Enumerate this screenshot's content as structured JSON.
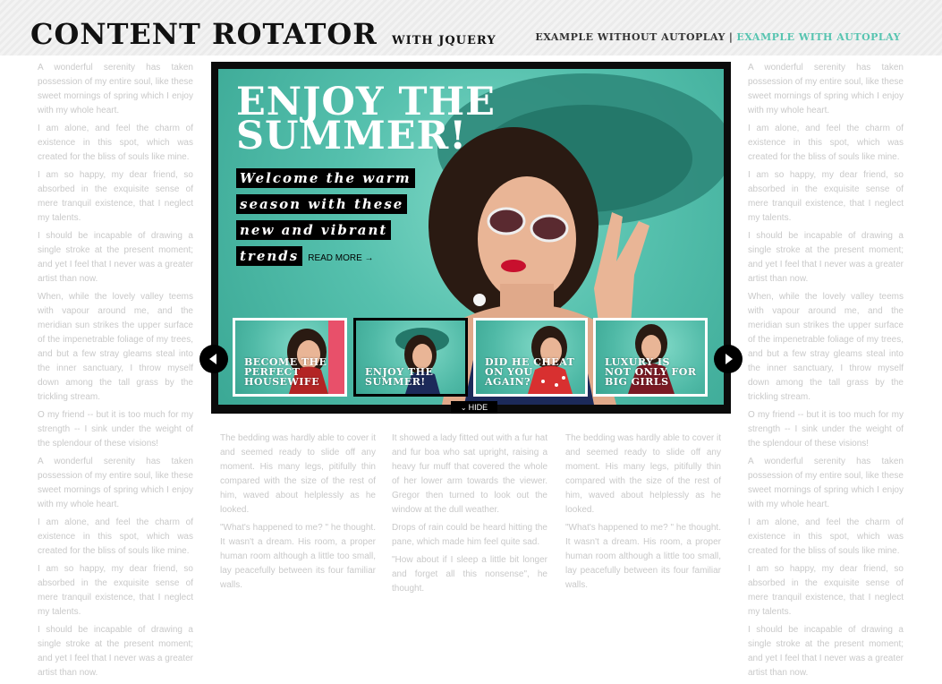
{
  "header": {
    "title": "Content Rotator",
    "subtitle": "with jQuery",
    "nav": {
      "without_autoplay": "Example without autoplay",
      "separator": "|",
      "with_autoplay": "Example with autoplay"
    }
  },
  "slide": {
    "headline": "Enjoy the Summer!",
    "description_lines": [
      "Welcome the warm",
      "season with these",
      "new and vibrant",
      "trends"
    ],
    "read_more": "READ MORE →"
  },
  "thumbnails": [
    {
      "label": "Become the perfect housewife"
    },
    {
      "label": "Enjoy the Summer!"
    },
    {
      "label": "Did he cheat on you again?"
    },
    {
      "label": "Luxury is not only for big girls"
    }
  ],
  "controls": {
    "prev_icon": "chevron-left-icon",
    "next_icon": "chevron-right-icon",
    "hide_label": "HIDE",
    "hide_icon": "double-chevron-down-icon"
  },
  "colors": {
    "accent": "#56c4b0",
    "slide_bg": "#55c0ad",
    "frame": "#0b0b0b"
  },
  "left_column": [
    "A wonderful serenity has taken possession of my entire soul, like these sweet mornings of spring which I enjoy with my whole heart.",
    "I am alone, and feel the charm of existence in this spot, which was created for the bliss of souls like mine.",
    "I am so happy, my dear friend, so absorbed in the exquisite sense of mere tranquil existence, that I neglect my talents.",
    "I should be incapable of drawing a single stroke at the present moment; and yet I feel that I never was a greater artist than now.",
    "When, while the lovely valley teems with vapour around me, and the meridian sun strikes the upper surface of the impenetrable foliage of my trees, and but a few stray gleams steal into the inner sanctuary, I throw myself down among the tall grass by the trickling stream.",
    "O my friend -- but it is too much for my strength -- I sink under the weight of the splendour of these visions!",
    "A wonderful serenity has taken possession of my entire soul, like these sweet mornings of spring which I enjoy with my whole heart.",
    "I am alone, and feel the charm of existence in this spot, which was created for the bliss of souls like mine.",
    "I am so happy, my dear friend, so absorbed in the exquisite sense of mere tranquil existence, that I neglect my talents.",
    "I should be incapable of drawing a single stroke at the present moment; and yet I feel that I never was a greater artist than now."
  ],
  "right_column": [
    "A wonderful serenity has taken possession of my entire soul, like these sweet mornings of spring which I enjoy with my whole heart.",
    "I am alone, and feel the charm of existence in this spot, which was created for the bliss of souls like mine.",
    "I am so happy, my dear friend, so absorbed in the exquisite sense of mere tranquil existence, that I neglect my talents.",
    "I should be incapable of drawing a single stroke at the present moment; and yet I feel that I never was a greater artist than now.",
    "When, while the lovely valley teems with vapour around me, and the meridian sun strikes the upper surface of the impenetrable foliage of my trees, and but a few stray gleams steal into the inner sanctuary, I throw myself down among the tall grass by the trickling stream.",
    "O my friend -- but it is too much for my strength -- I sink under the weight of the splendour of these visions!",
    "A wonderful serenity has taken possession of my entire soul, like these sweet mornings of spring which I enjoy with my whole heart.",
    "I am alone, and feel the charm of existence in this spot, which was created for the bliss of souls like mine.",
    "I am so happy, my dear friend, so absorbed in the exquisite sense of mere tranquil existence, that I neglect my talents.",
    "I should be incapable of drawing a single stroke at the present moment; and yet I feel that I never was a greater artist than now."
  ],
  "bottom_columns": [
    [
      "The bedding was hardly able to cover it and seemed ready to slide off any moment. His many legs, pitifully thin compared with the size of the rest of him, waved about helplessly as he looked.",
      "\"What's happened to me? \" he thought. It wasn't a dream. His room, a proper human room although a little too small, lay peacefully between its four familiar walls."
    ],
    [
      "It showed a lady fitted out with a fur hat and fur boa who sat upright, raising a heavy fur muff that covered the whole of her lower arm towards the viewer. Gregor then turned to look out the window at the dull weather.",
      "Drops of rain could be heard hitting the pane, which made him feel quite sad.",
      "\"How about if I sleep a little bit longer and forget all this nonsense\", he thought."
    ],
    [
      "The bedding was hardly able to cover it and seemed ready to slide off any moment. His many legs, pitifully thin compared with the size of the rest of him, waved about helplessly as he looked.",
      "\"What's happened to me? \" he thought. It wasn't a dream. His room, a proper human room although a little too small, lay peacefully between its four familiar walls."
    ]
  ]
}
